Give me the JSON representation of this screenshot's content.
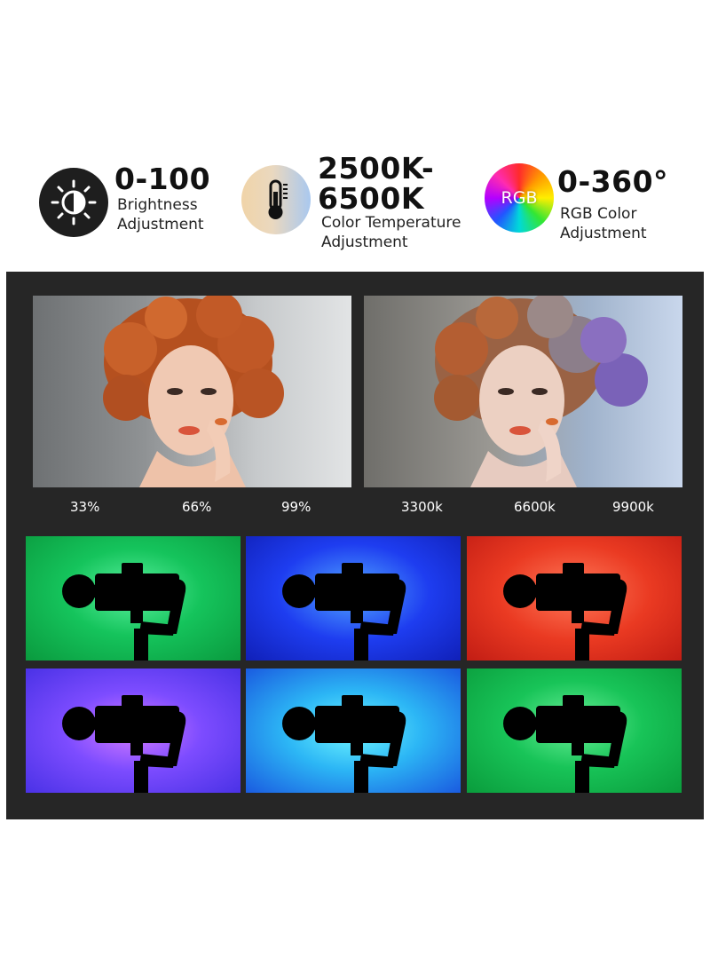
{
  "features": {
    "brightness": {
      "value": "0-100",
      "label_line1": "Brightness",
      "label_line2": "Adjustment",
      "icon": "brightness-icon"
    },
    "temperature": {
      "value_line1": "2500K-",
      "value_line2": "6500K",
      "label_line1": "Color Temperature",
      "label_line2": "Adjustment",
      "icon": "thermometer-icon"
    },
    "rgb": {
      "value": "0-360°",
      "icon_text": "RGB",
      "label_line1": "RGB Color",
      "label_line2": "Adjustment",
      "icon": "rgb-color-wheel-icon"
    }
  },
  "brightness_scale": [
    "33%",
    "66%",
    "99%"
  ],
  "temperature_scale": [
    "3300k",
    "6600k",
    "9900k"
  ],
  "rgb_tiles": [
    {
      "color": "#15c45c",
      "icon": "gimbal-silhouette"
    },
    {
      "color": "#1e3df0",
      "icon": "gimbal-silhouette"
    },
    {
      "color": "#ea3a22",
      "icon": "gimbal-silhouette"
    },
    {
      "color": "#7d4cff",
      "icon": "gimbal-silhouette"
    },
    {
      "color": "#2cb6f5",
      "icon": "gimbal-silhouette"
    },
    {
      "color": "#18c458",
      "icon": "gimbal-silhouette"
    }
  ]
}
